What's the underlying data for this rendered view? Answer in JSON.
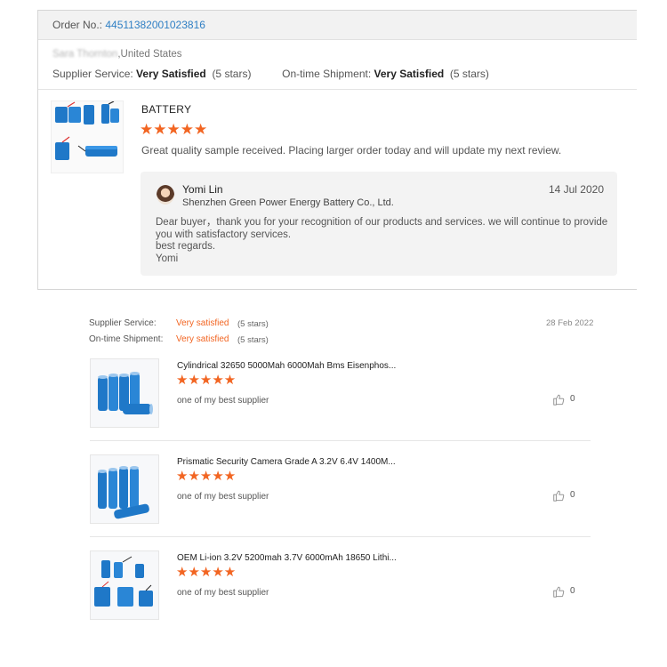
{
  "order": {
    "label": "Order No.: ",
    "number": "44511382001023816"
  },
  "buyer": {
    "name_blurred": "Sara Thornton",
    "country": ",United States"
  },
  "ratings": {
    "supplier_label": "Supplier Service: ",
    "supplier_value": "Very Satisfied",
    "supplier_count": "(5 stars)",
    "shipment_label": "On-time Shipment: ",
    "shipment_value": "Very Satisfied",
    "shipment_count": "(5 stars)"
  },
  "review": {
    "product_title": "BATTERY",
    "stars": "★★★★★",
    "text": "Great quality sample received. Placing larger order today and will update my next review."
  },
  "reply": {
    "name": "Yomi Lin",
    "company": "Shenzhen Green Power Energy Battery Co., Ltd.",
    "date": "14 Jul 2020",
    "line1": "Dear buyer，thank you for your recognition of our products and services. we will continue to provide",
    "line2": "you with satisfactory services.",
    "line3": "best regards.",
    "line4": "Yomi"
  },
  "section2": {
    "supplier_label": "Supplier Service:",
    "supplier_value": "Very satisfied",
    "supplier_count": "(5 stars)",
    "shipment_label": "On-time Shipment:",
    "shipment_value": "Very satisfied",
    "shipment_count": "(5 stars)",
    "date": "28 Feb 2022",
    "items": [
      {
        "title": "Cylindrical 32650 5000Mah 6000Mah Bms Eisenphos...",
        "stars": "★★★★★",
        "comment": "one of my best supplier",
        "likes": "0"
      },
      {
        "title": "Prismatic Security Camera Grade A 3.2V 6.4V 1400M...",
        "stars": "★★★★★",
        "comment": "one of my best supplier",
        "likes": "0"
      },
      {
        "title": "OEM Li-ion 3.2V 5200mah 3.7V 6000mAh 18650 Lithi...",
        "stars": "★★★★★",
        "comment": "one of my best supplier",
        "likes": "0"
      }
    ]
  },
  "colors": {
    "accent_orange": "#f26522",
    "link_blue": "#2f7fc4",
    "battery_blue": "#1f78c8"
  },
  "icons": {
    "like": "thumbs-up-icon"
  }
}
